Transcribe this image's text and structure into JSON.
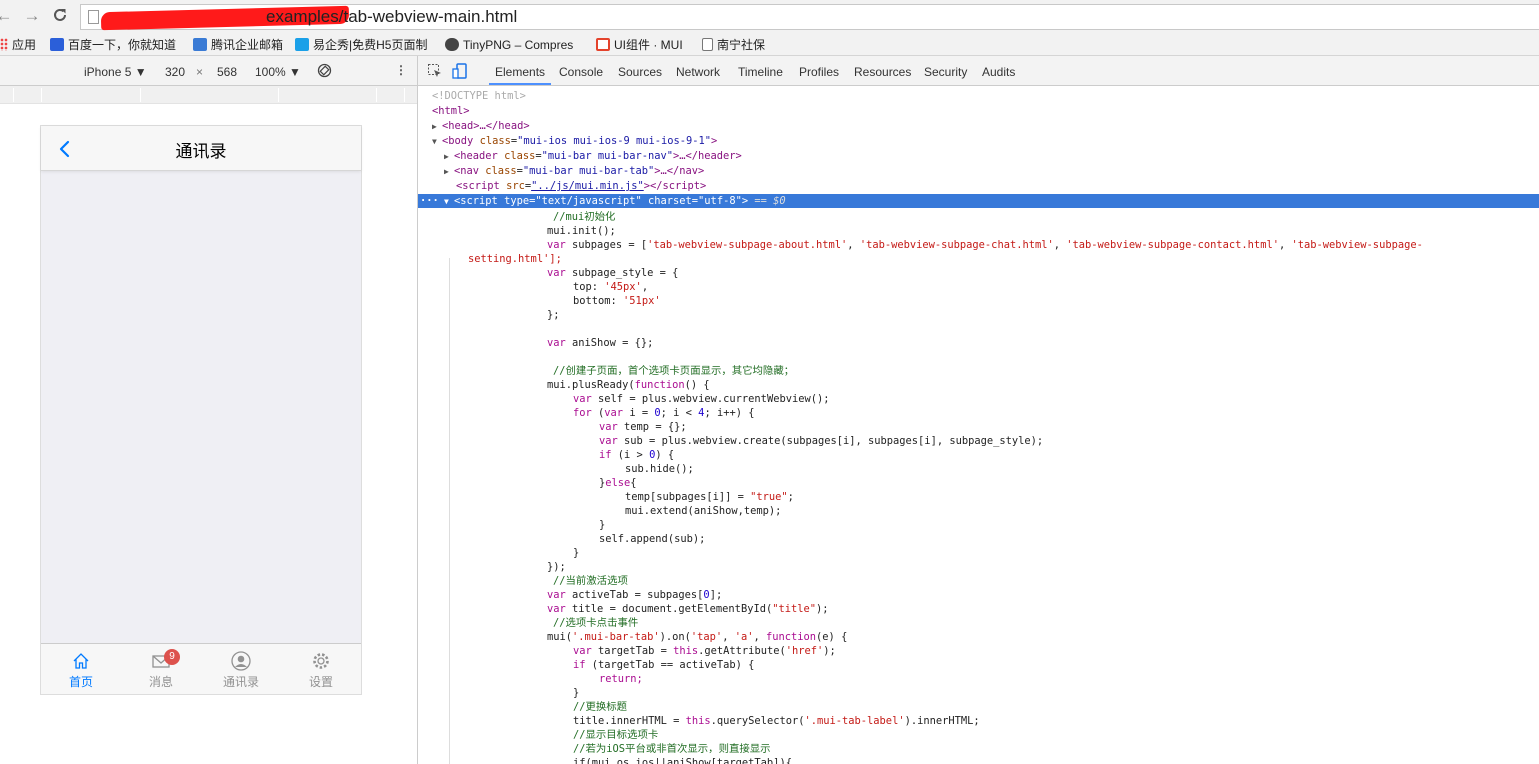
{
  "browser": {
    "url_visible": "examples/tab-webview-main.html",
    "bookmarks": [
      {
        "label": "应用",
        "icon": "apps-icon"
      },
      {
        "label": "百度一下，你就知道",
        "icon": "baidu-icon"
      },
      {
        "label": "腾讯企业邮箱",
        "icon": "mail-icon"
      },
      {
        "label": "易企秀|免费H5页面制",
        "icon": "xiu-icon"
      },
      {
        "label": "TinyPNG – Compres",
        "icon": "panda-icon"
      },
      {
        "label": "UI组件 · MUI",
        "icon": "mui-icon"
      },
      {
        "label": "南宁社保",
        "icon": "page-icon"
      }
    ]
  },
  "device_toolbar": {
    "device": "iPhone 5 ▼",
    "width": "320",
    "times": "×",
    "height": "568",
    "zoom": "100% ▼"
  },
  "phone": {
    "title": "通讯录",
    "badge": "9",
    "tabs": [
      {
        "label": "首页",
        "icon": "home-icon",
        "active": true
      },
      {
        "label": "消息",
        "icon": "mail-icon",
        "active": false
      },
      {
        "label": "通讯录",
        "icon": "contact-icon",
        "active": false
      },
      {
        "label": "设置",
        "icon": "gear-icon",
        "active": false
      }
    ]
  },
  "devtools": {
    "tabs": [
      "Elements",
      "Console",
      "Sources",
      "Network",
      "Timeline",
      "Profiles",
      "Resources",
      "Security",
      "Audits"
    ],
    "active_tab": "Elements",
    "dom": {
      "doctype": "<!DOCTYPE html>",
      "html_open": "<html>",
      "head": "<head>…</head>",
      "body_tag": "body",
      "body_attr": "class",
      "body_value": "\"mui-ios mui-ios-9 mui-ios-9-1\"",
      "header_attr_value": "\"mui-bar mui-bar-nav\"",
      "nav_attr_value": "\"mui-bar mui-bar-tab\"",
      "script_src": "\"../js/mui.min.js\"",
      "selected_type": "\"text/javascript\"",
      "selected_charset": "\"utf-8\"",
      "selected_suffix": "== $0"
    },
    "code_lines": [
      "//mui初始化",
      "mui.init();",
      "var subpages = ['tab-webview-subpage-about.html', 'tab-webview-subpage-chat.html', 'tab-webview-subpage-contact.html', 'tab-webview-subpage-",
      "setting.html'];",
      "var subpage_style = {",
      "top: '45px',",
      "bottom: '51px'",
      "};",
      "var aniShow = {};",
      "//创建子页面，首个选项卡页面显示，其它均隐藏；",
      "mui.plusReady(function() {",
      "var self = plus.webview.currentWebview();",
      "for (var i = 0; i < 4; i++) {",
      "var temp = {};",
      "var sub = plus.webview.create(subpages[i], subpages[i], subpage_style);",
      "if (i > 0) {",
      "sub.hide();",
      "}else{",
      "temp[subpages[i]] = \"true\";",
      "mui.extend(aniShow,temp);",
      "}",
      "self.append(sub);",
      "}",
      "});",
      "//当前激活选项",
      "var activeTab = subpages[0];",
      "var title = document.getElementById(\"title\");",
      "//选项卡点击事件",
      "mui('.mui-bar-tab').on('tap', 'a', function(e) {",
      "var targetTab = this.getAttribute('href');",
      "if (targetTab == activeTab) {",
      "return;",
      "}",
      "//更换标题",
      "title.innerHTML = this.querySelector('.mui-tab-label').innerHTML;",
      "//显示目标选项卡",
      "//若为iOS平台或非首次显示，则直接显示",
      "if(mui.os.ios||aniShow[targetTab]){"
    ]
  }
}
